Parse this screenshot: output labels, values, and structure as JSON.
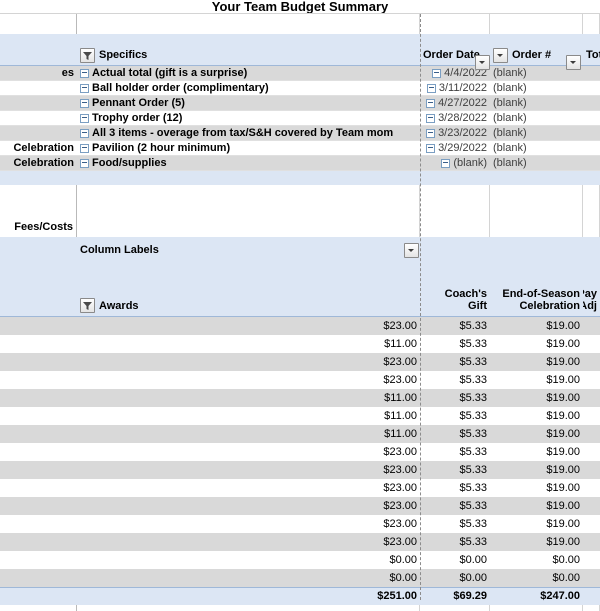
{
  "title": "Your Team Budget Summary",
  "icons": {
    "filter": "filter-icon",
    "dropdown": "dropdown-arrow-icon",
    "collapse": "collapse-minus-icon"
  },
  "colors": {
    "header_blue": "#DCE6F4",
    "band_gray": "#D9D9D9",
    "grid_line": "#D4D4D4",
    "page_break": "#8C8C8C"
  },
  "table1": {
    "headers": {
      "rowlabel": "",
      "specifics": "Specifics",
      "order_date": "Order Date",
      "order_num": "Order #",
      "total": "Tota"
    },
    "rows": [
      {
        "rowlabel": "es",
        "specifics": "Actual total (gift is a surprise)",
        "order_date": "4/4/2022",
        "order_num": "(blank)",
        "total": ""
      },
      {
        "rowlabel": "",
        "specifics": "Ball holder order (complimentary)",
        "order_date": "3/11/2022",
        "order_num": "(blank)",
        "total": ""
      },
      {
        "rowlabel": "",
        "specifics": "Pennant Order (5)",
        "order_date": "4/27/2022",
        "order_num": "(blank)",
        "total": ""
      },
      {
        "rowlabel": "",
        "specifics": "Trophy order (12)",
        "order_date": "3/28/2022",
        "order_num": "(blank)",
        "total": ""
      },
      {
        "rowlabel": "",
        "specifics": "All 3 items - overage from tax/S&H covered by Team mom",
        "order_date": "3/23/2022",
        "order_num": "(blank)",
        "total": ""
      },
      {
        "rowlabel": "Celebration",
        "specifics": "Pavilion (2 hour minimum)",
        "order_date": "3/29/2022",
        "order_num": "(blank)",
        "total": ""
      },
      {
        "rowlabel": "Celebration",
        "specifics": "Food/supplies",
        "order_date": "(blank)",
        "order_num": "(blank)",
        "total": ""
      }
    ]
  },
  "middle": {
    "fees_costs_label": "Fees/Costs",
    "column_labels": "Column Labels"
  },
  "table2": {
    "headers": {
      "rowlabel": "",
      "awards": "Awards",
      "coachs_gift": "Coach's Gift",
      "end_of_season": "End-of-Season Celebration",
      "payment": "Pay Adj"
    },
    "rows": [
      {
        "awards": "$23.00",
        "coachs_gift": "$5.33",
        "end_of_season": "$19.00"
      },
      {
        "awards": "$11.00",
        "coachs_gift": "$5.33",
        "end_of_season": "$19.00"
      },
      {
        "awards": "$23.00",
        "coachs_gift": "$5.33",
        "end_of_season": "$19.00"
      },
      {
        "awards": "$23.00",
        "coachs_gift": "$5.33",
        "end_of_season": "$19.00"
      },
      {
        "awards": "$11.00",
        "coachs_gift": "$5.33",
        "end_of_season": "$19.00"
      },
      {
        "awards": "$11.00",
        "coachs_gift": "$5.33",
        "end_of_season": "$19.00"
      },
      {
        "awards": "$11.00",
        "coachs_gift": "$5.33",
        "end_of_season": "$19.00"
      },
      {
        "awards": "$23.00",
        "coachs_gift": "$5.33",
        "end_of_season": "$19.00"
      },
      {
        "awards": "$23.00",
        "coachs_gift": "$5.33",
        "end_of_season": "$19.00"
      },
      {
        "awards": "$23.00",
        "coachs_gift": "$5.33",
        "end_of_season": "$19.00"
      },
      {
        "awards": "$23.00",
        "coachs_gift": "$5.33",
        "end_of_season": "$19.00"
      },
      {
        "awards": "$23.00",
        "coachs_gift": "$5.33",
        "end_of_season": "$19.00"
      },
      {
        "awards": "$23.00",
        "coachs_gift": "$5.33",
        "end_of_season": "$19.00"
      },
      {
        "awards": "$0.00",
        "coachs_gift": "$0.00",
        "end_of_season": "$0.00"
      },
      {
        "awards": "$0.00",
        "coachs_gift": "$0.00",
        "end_of_season": "$0.00"
      }
    ],
    "total": {
      "awards": "$251.00",
      "coachs_gift": "$69.29",
      "end_of_season": "$247.00"
    }
  }
}
